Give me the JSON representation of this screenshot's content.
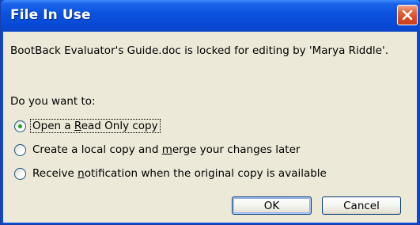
{
  "dialog": {
    "title": "File In Use",
    "close_icon": "close-icon",
    "message": "BootBack Evaluator's Guide.doc is locked for editing by 'Marya Riddle'.",
    "prompt": "Do you want to:",
    "options": [
      {
        "label_pre": "Open a ",
        "label_mnemonic": "R",
        "label_post": "ead Only copy",
        "selected": true
      },
      {
        "label_pre": "Create a local copy and ",
        "label_mnemonic": "m",
        "label_post": "erge your changes later",
        "selected": false
      },
      {
        "label_pre": "Receive ",
        "label_mnemonic": "n",
        "label_post": "otification when the original copy is available",
        "selected": false
      }
    ],
    "ok_label": "OK",
    "cancel_label": "Cancel"
  },
  "colors": {
    "titlebar": "#0a52de",
    "client": "#ece9d8",
    "close_button": "#d64a22",
    "radio_dot": "#21a121"
  }
}
